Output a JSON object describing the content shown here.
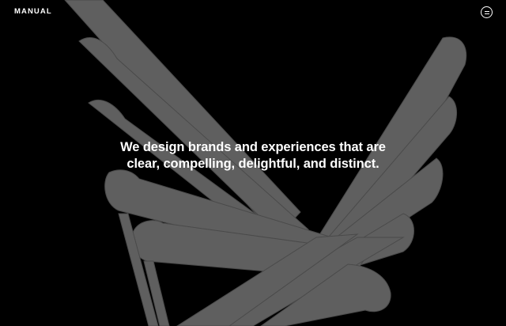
{
  "header": {
    "logo_text": "MANUAL",
    "menu_icon": "menu-icon"
  },
  "hero": {
    "headline": "We design brands and experiences that are clear, compelling, delightful, and distinct.",
    "art_icon": "sculpture-wings",
    "background_color": "#000000",
    "art_color": "#5f5f5f"
  }
}
